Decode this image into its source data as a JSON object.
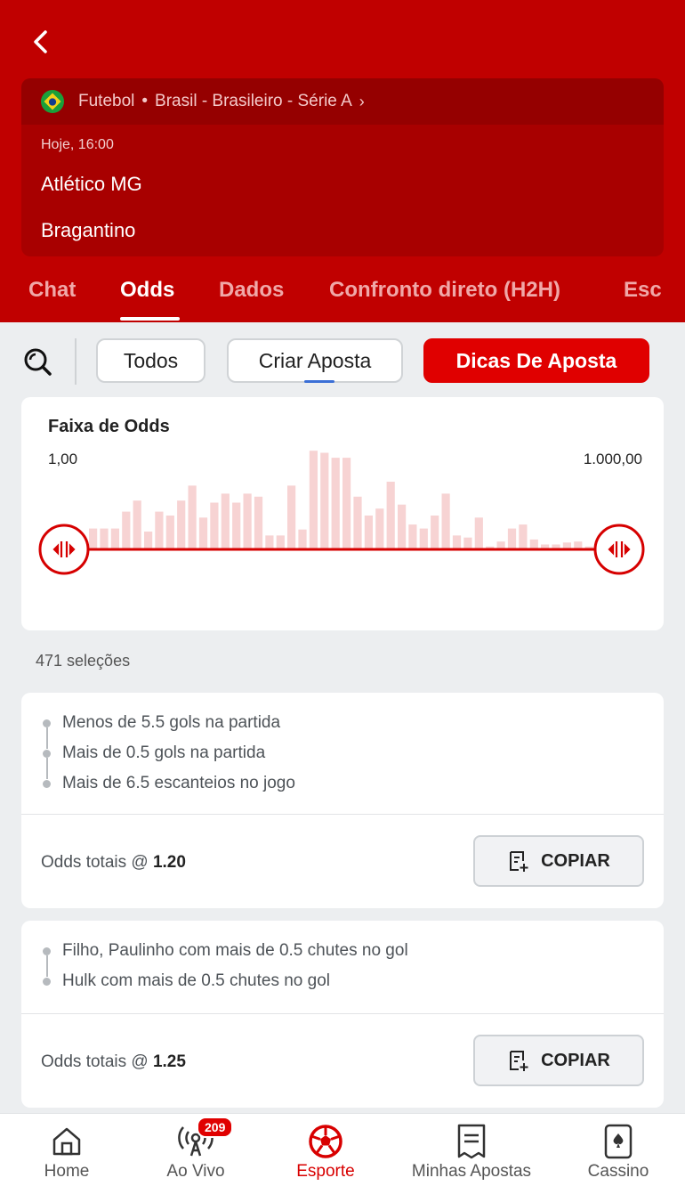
{
  "match": {
    "sport": "Futebol",
    "league": "Brasil - Brasileiro - Série A",
    "time": "Hoje, 16:00",
    "home_team": "Atlético MG",
    "away_team": "Bragantino"
  },
  "tabs": [
    {
      "label": "Chat",
      "active": false
    },
    {
      "label": "Odds",
      "active": true
    },
    {
      "label": "Dados",
      "active": false
    },
    {
      "label": "Confronto direto (H2H)",
      "active": false
    },
    {
      "label": "Esc",
      "active": false
    }
  ],
  "filters": {
    "todos": "Todos",
    "criar_aposta": "Criar Aposta",
    "dicas_de_aposta": "Dicas De Aposta"
  },
  "odds_range": {
    "title": "Faixa de Odds",
    "min_label": "1,00",
    "max_label": "1.000,00",
    "selected_min_fraction": 0.0,
    "selected_max_fraction": 1.0,
    "histogram_relative_heights": [
      0.2,
      0.2,
      0.2,
      0.37,
      0.48,
      0.17,
      0.37,
      0.33,
      0.48,
      0.63,
      0.31,
      0.46,
      0.55,
      0.46,
      0.55,
      0.52,
      0.13,
      0.13,
      0.63,
      0.19,
      0.98,
      0.96,
      0.91,
      0.91,
      0.52,
      0.33,
      0.4,
      0.67,
      0.44,
      0.24,
      0.2,
      0.33,
      0.55,
      0.13,
      0.11,
      0.31,
      0.02,
      0.07,
      0.2,
      0.24,
      0.09,
      0.04,
      0.04,
      0.06,
      0.07,
      0.02
    ]
  },
  "selections_count": "471 seleções",
  "colors": {
    "brand_red": "#c00000",
    "accent_red": "#e00000"
  },
  "bets": [
    {
      "legs": [
        "Menos de 5.5 gols na partida",
        "Mais de 0.5 gols na partida",
        "Mais de 6.5 escanteios no jogo"
      ],
      "odds_prefix": "Odds totais @",
      "odds_value": "1.20",
      "copy_label": "COPIAR"
    },
    {
      "legs": [
        "Filho, Paulinho com mais de 0.5 chutes no gol",
        "Hulk com mais de 0.5 chutes no gol"
      ],
      "odds_prefix": "Odds totais @",
      "odds_value": "1.25",
      "copy_label": "COPIAR"
    }
  ],
  "bottom_nav": [
    {
      "label": "Home",
      "icon": "home-icon",
      "active": false
    },
    {
      "label": "Ao Vivo",
      "icon": "live-broadcast-icon",
      "badge": "209",
      "active": false
    },
    {
      "label": "Esporte",
      "icon": "soccer-ball-icon",
      "active": true
    },
    {
      "label": "Minhas Apostas",
      "icon": "bet-slip-icon",
      "active": false
    },
    {
      "label": "Cassino",
      "icon": "playing-card-icon",
      "active": false
    }
  ]
}
